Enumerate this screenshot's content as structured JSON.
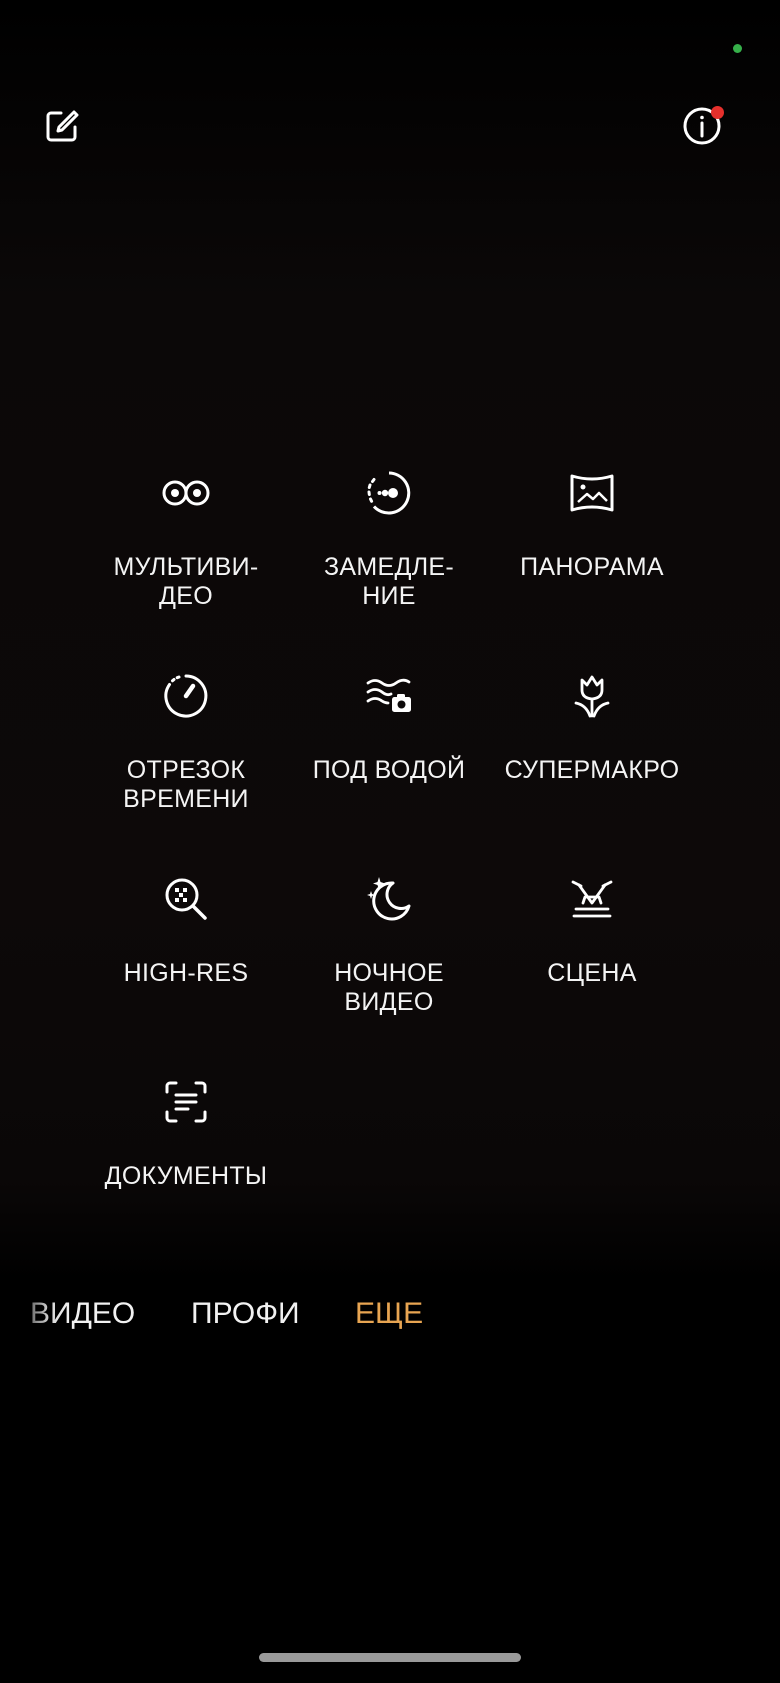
{
  "top_bar": {
    "edit_icon": "edit-square-icon",
    "info_icon": "info-circle-icon",
    "info_badge_color": "#e5302c",
    "status_dot_color": "#36b04a"
  },
  "modes": [
    {
      "id": "multivideo",
      "label": "МУЛЬТИВИ-\nДЕО",
      "icon": "multivideo-icon"
    },
    {
      "id": "slowmo",
      "label": "ЗАМЕДЛЕ-\nНИЕ",
      "icon": "slow-motion-icon"
    },
    {
      "id": "panorama",
      "label": "ПАНОРАМА",
      "icon": "panorama-icon"
    },
    {
      "id": "timelapse",
      "label": "ОТРЕЗОК\nВРЕМЕНИ",
      "icon": "timelapse-icon"
    },
    {
      "id": "underwater",
      "label": "ПОД ВОДОЙ",
      "icon": "underwater-camera-icon"
    },
    {
      "id": "supermacro",
      "label": "СУПЕРМАКРО",
      "icon": "tulip-macro-icon"
    },
    {
      "id": "highres",
      "label": "HIGH-RES",
      "icon": "high-res-magnifier-icon"
    },
    {
      "id": "nightvideo",
      "label": "НОЧНОЕ\nВИДЕО",
      "icon": "night-moon-icon"
    },
    {
      "id": "stage",
      "label": "СЦЕНА",
      "icon": "stage-spotlight-icon"
    },
    {
      "id": "documents",
      "label": "ДОКУМЕНТЫ",
      "icon": "document-scan-icon"
    }
  ],
  "mode_tabs": {
    "video": "ВИДЕО",
    "pro": "ПРОФИ",
    "more": "ЕЩЕ",
    "active": "more",
    "active_color": "#e8a552"
  }
}
